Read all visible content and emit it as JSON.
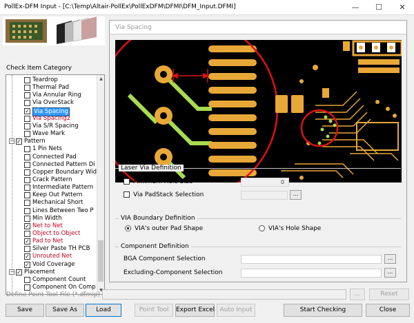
{
  "window": {
    "title": "PollEx-DFM Input - [C:\\Temp\\Altair-PollEx\\PollExDFM\\DFMI\\DFM_Input.DFMI]",
    "minimize": "—",
    "maximize": "☐",
    "close": "✕"
  },
  "left": {
    "category_label": "Check Item Category",
    "tree": [
      {
        "label": "Teardrop",
        "checked": false
      },
      {
        "label": "Thermal Pad",
        "checked": false
      },
      {
        "label": "Via Annular Ring",
        "checked": false
      },
      {
        "label": "Via OverStack",
        "checked": false
      },
      {
        "label": "Via Spacing",
        "checked": true,
        "selected": true
      },
      {
        "label": "Via Spacing2",
        "checked": false,
        "red": true
      },
      {
        "label": "Via S/R Spacing",
        "checked": false
      },
      {
        "label": "Wave Mark",
        "checked": false
      },
      {
        "label": "Pattern",
        "checked": true,
        "group": true,
        "expander": "−"
      },
      {
        "label": "1 Pin Nets",
        "checked": false
      },
      {
        "label": "Connected Pad",
        "checked": false
      },
      {
        "label": "Connected Pattern Di",
        "checked": false
      },
      {
        "label": "Copper Boundary Wid",
        "checked": false
      },
      {
        "label": "Crack Pattern",
        "checked": false
      },
      {
        "label": "Intermediate Pattern",
        "checked": false
      },
      {
        "label": "Keep Out Pattern",
        "checked": false
      },
      {
        "label": "Mechanical Short",
        "checked": false
      },
      {
        "label": "Lines Between Two P",
        "checked": false
      },
      {
        "label": "Min Width",
        "checked": false
      },
      {
        "label": "Net to Net",
        "checked": true,
        "red": true
      },
      {
        "label": "Object to Object",
        "checked": false,
        "red": true
      },
      {
        "label": "Pad to Net",
        "checked": true,
        "red": true
      },
      {
        "label": "Silver Paste TH PCB",
        "checked": false
      },
      {
        "label": "Unrouted Net",
        "checked": true,
        "red": true
      },
      {
        "label": "Void Coverage",
        "checked": true
      },
      {
        "label": "Placement",
        "checked": true,
        "group": true,
        "expander": "−"
      },
      {
        "label": "Component Count",
        "checked": false
      },
      {
        "label": "Component On Comp",
        "checked": false
      }
    ]
  },
  "panel": {
    "header": "Via Spacing",
    "laser": {
      "title": "Laser Via Definition",
      "min_hole_label": "Minimum Hole Size",
      "min_hole_value": "0",
      "padstack_label": "Via PadStack Selection",
      "dots": "..."
    },
    "boundary": {
      "title": "VIA Boundary Definition",
      "outer_label": "VIA's outer Pad Shape",
      "hole_label": "VIA's Hole Shape"
    },
    "component": {
      "title": "Component Definition",
      "bga_label": "BGA Component Selection",
      "excl_label": "Excluding-Component Selection",
      "dots": "..."
    }
  },
  "bottom": {
    "define_label": "Define Point Tool File (*.dfmip)",
    "browse": "...",
    "reset": "Reset",
    "buttons": {
      "save": "Save",
      "save_as": "Save As",
      "load": "Load",
      "point_tool": "Point Tool",
      "export_excel": "Export Excel",
      "auto_input": "Auto Input",
      "start_checking": "Start Checking",
      "close": "Close"
    }
  },
  "colors": {
    "pcb_trace": "#e8a838",
    "pcb_green": "#a8dc50",
    "highlight_circle": "#e01010",
    "selection": "#3399ff"
  }
}
